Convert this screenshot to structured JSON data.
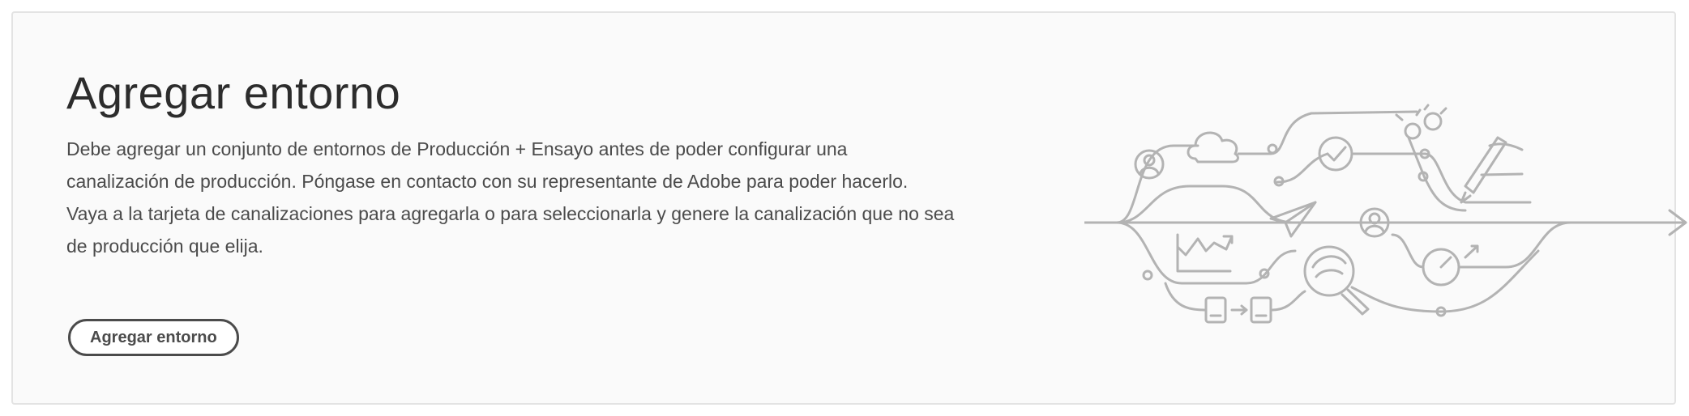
{
  "card": {
    "title": "Agregar entorno",
    "description_lines": [
      "Debe agregar un conjunto de entornos de Producción + Ensayo antes de poder configurar una",
      "canalización de producción. Póngase en contacto con su representante de Adobe para poder hacerlo.",
      "Vaya a la tarjeta de canalizaciones para agregarla o para seleccionarla y genere la canalización que no sea",
      "de producción que elija."
    ],
    "button_label": "Agregar entorno"
  },
  "illustration": {
    "icons": [
      "user-icon",
      "cloud-icon",
      "checkmark-icon",
      "gears-icon",
      "pen-icon",
      "chart-icon",
      "paper-plane-icon",
      "magnifier-icon",
      "speedometer-icon",
      "document-icon",
      "arrow-icon"
    ]
  },
  "colors": {
    "title": "#2c2c2c",
    "text": "#4b4b4b",
    "border": "#e3e3e3",
    "illustration": "#b3b3b3"
  }
}
